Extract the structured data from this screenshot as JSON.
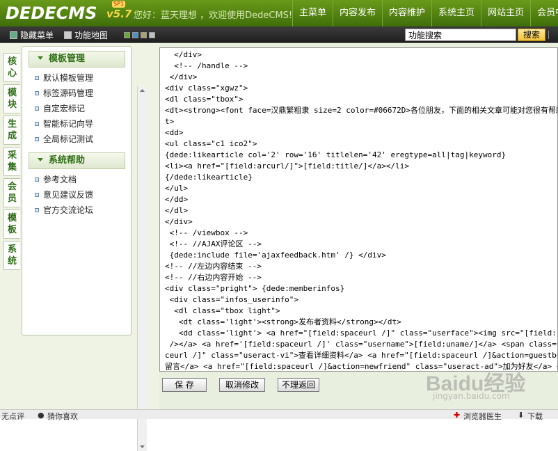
{
  "header": {
    "logo": "DEDECMS",
    "version": "v5.7",
    "badge": "SP1",
    "greeting": "您好：蓝天理想 ，欢迎使用DedeCMS!",
    "nav": [
      "主菜单",
      "内容发布",
      "内容维护",
      "系统主页",
      "网站主页",
      "会员中"
    ]
  },
  "toolbar": {
    "hide_menu": "隐藏菜单",
    "function_map": "功能地图",
    "search_placeholder": "功能搜索",
    "search_button": "搜索",
    "swatch_colors": [
      "#6aa83a",
      "#4a8fd0",
      "#b0a070",
      "#c0c0c0"
    ]
  },
  "sidebar": {
    "tabs": [
      "核心",
      "模块",
      "生成",
      "采集",
      "会员",
      "模板",
      "系统"
    ],
    "active_tab": "模板",
    "sections": [
      {
        "title": "模板管理",
        "items": [
          "默认模板管理",
          "标签源码管理",
          "自定宏标记",
          "智能标记向导",
          "全局标记测试"
        ]
      },
      {
        "title": "系统帮助",
        "items": [
          "参考文档",
          "意见建议反馈",
          "官方交流论坛"
        ]
      }
    ]
  },
  "editor": {
    "lines": [
      "  </div>",
      "  <!-- /handle -->",
      " </div>",
      "<div class=\"xgwz\">",
      "<dl class=\"tbox\">",
      "<dt><strong><font face=汉鼎繁粗隶 size=2 color=#06672D>各位朋友，下面的相关文章可能对您很有帮助",
      "t>",
      "<dd>",
      "<ul class=\"c1 ico2\">",
      "{dede:likearticle col='2' row='16' titlelen='42' eregtype=all|tag|keyword}",
      "<li><a href=\"[field:arcurl/]\">[field:title/]</a></li>",
      "{/dede:likearticle}",
      "</ul>",
      "</dd>",
      "</dl>",
      "</div>",
      " <!-- /viewbox -->",
      " <!-- //AJAX评论区 -->",
      " {dede:include file='ajaxfeedback.htm' /} </div>",
      "<!-- //左边内容结束 -->",
      "<!-- //右边内容开始 -->",
      "<div class=\"pright\"> {dede:memberinfos}",
      " <div class=\"infos_userinfo\">",
      "  <dl class=\"tbox light\">",
      "   <dt class='light'><strong>发布者资料</strong></dt>",
      "   <dd class='light'> <a href=\"[field:spaceurl /]\" class=\"userface\"><img src=\"[field:face/]\" w",
      " /></a> <a href='[field:spaceurl /]' class=\"username\">[field:uname/]</a> <span class=\"useract\"",
      "ceurl /]\" class=\"useract-vi\">查看详细资料</a> <a href=\"[field:spaceurl /]&action=guestbook\" cl",
      "留言</a> <a href=\"[field:spaceurl /]&action=newfriend\" class=\"useract-ad\">加为好友</a> </span>"
    ]
  },
  "actions": {
    "save": "保 存",
    "cancel": "取消修改",
    "back": "不理返回"
  },
  "status": {
    "left_text": "无点评",
    "like_text": "猜你喜欢",
    "doctor": "浏览器医生",
    "download": "下载"
  },
  "watermark": {
    "main": "Baidu经验",
    "sub": "jingyan.baidu.com"
  }
}
